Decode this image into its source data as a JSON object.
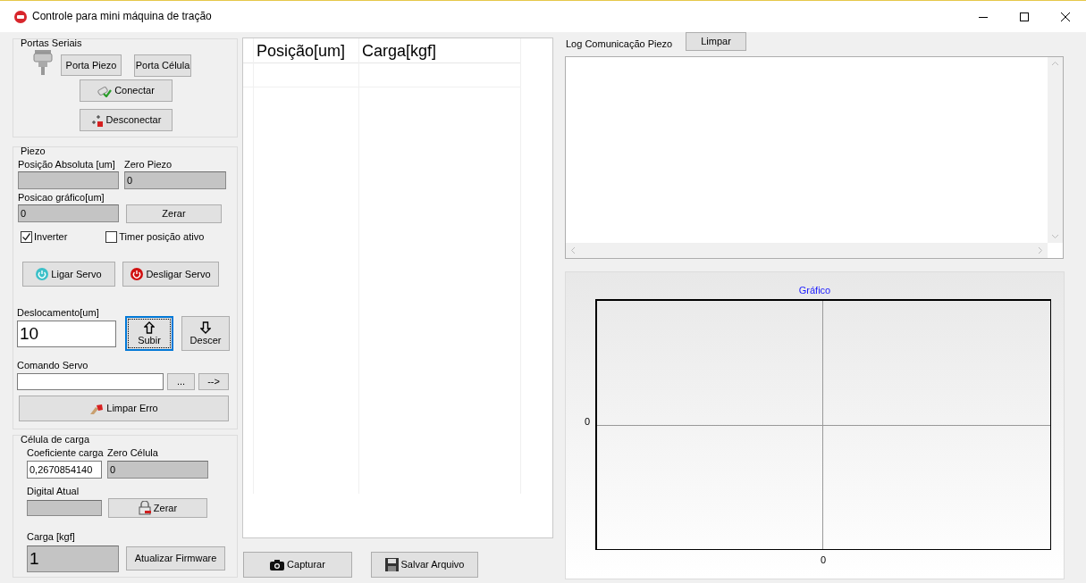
{
  "window": {
    "title": "Controle para mini máquina de tração"
  },
  "serial_ports": {
    "title": "Portas Seriais",
    "piezo_port_button": "Porta Piezo",
    "cell_port_button": "Porta Célula",
    "connect_button": "Conectar",
    "disconnect_button": "Desconectar"
  },
  "piezo": {
    "title": "Piezo",
    "absolute_position": {
      "label": "Posição Absoluta [um]",
      "readonly": true
    },
    "zero_piezo": {
      "label": "Zero Piezo",
      "value": "0",
      "readonly": true
    },
    "graph_position": {
      "label": "Posicao gráfico[um]",
      "value": "0",
      "readonly": true
    },
    "zero_button": "Zerar",
    "checkboxes": [
      {
        "label": "Inverter",
        "checked": true
      },
      {
        "label": "Timer posição ativo",
        "checked": false
      }
    ],
    "servo_on_button": "Ligar Servo",
    "servo_off_button": "Desligar Servo",
    "displacement": {
      "label": "Deslocamento[um]",
      "value": "10",
      "readonly": false
    },
    "move_buttons": [
      {
        "label": "Subir",
        "kind": "up",
        "focused": true
      },
      {
        "label": "Descer",
        "kind": "down",
        "focused": false
      }
    ],
    "servo_command": {
      "label": "Comando Servo",
      "readonly": false
    },
    "browse_button": "...",
    "send_button": "-->",
    "clear_error_button": "Limpar Erro"
  },
  "load_cell": {
    "title": "Célula de carga",
    "coefficient": {
      "label": "Coeficiente carga",
      "value": "0,2670854140",
      "readonly": false
    },
    "zero_cell": {
      "label": "Zero Célula",
      "value": "0",
      "readonly": true
    },
    "digital": {
      "label": "Digital Atual",
      "readonly": true
    },
    "zero_button": "Zerar",
    "load": {
      "label": "Carga [kgf]",
      "value": "1",
      "readonly": true
    },
    "firmware_button": "Atualizar Firmware"
  },
  "table": {
    "columns": [
      "Posição[um]",
      "Carga[kgf]"
    ]
  },
  "capture_button": "Capturar",
  "save_button": "Salvar Arquivo",
  "log": {
    "label": "Log Comunicação Piezo",
    "clear_button": "Limpar"
  },
  "chart": {
    "title": "Gráfico",
    "y_tick": "0",
    "x_tick": "0"
  }
}
